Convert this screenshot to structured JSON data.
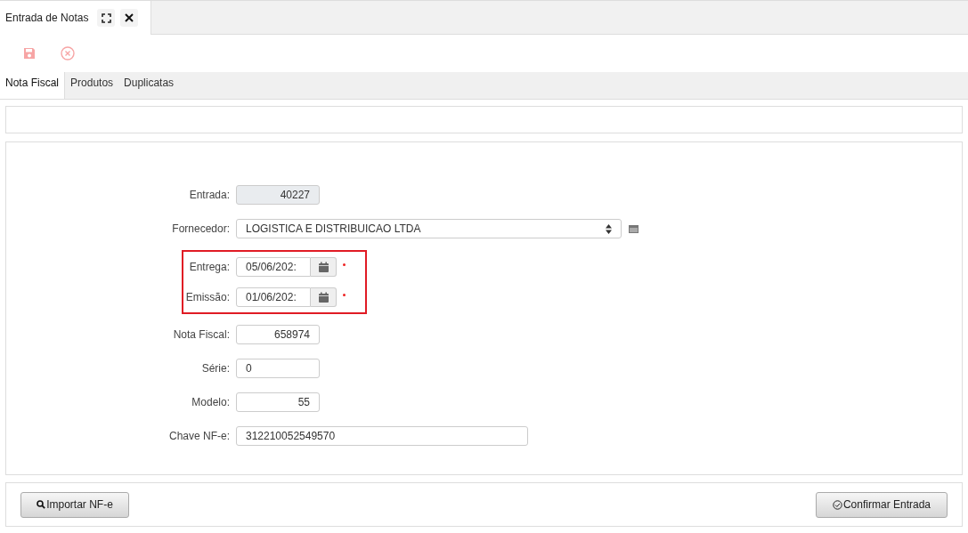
{
  "window_tab": {
    "title": "Entrada de Notas"
  },
  "toolbar": [
    {
      "kind": "save",
      "disabled": true
    },
    {
      "kind": "cancel",
      "disabled": true
    }
  ],
  "tabs": [
    {
      "label": "Nota Fiscal",
      "selected": true
    },
    {
      "label": "Produtos",
      "selected": false
    },
    {
      "label": "Duplicatas",
      "selected": false
    }
  ],
  "fields": [
    {
      "kind": "number",
      "label": "Entrada:",
      "value": "40227",
      "disabled": true
    },
    {
      "kind": "select",
      "label": "Fornecedor:",
      "value": "LOGISTICA E DISTRIBUICAO LTDA"
    },
    {
      "kind": "group",
      "highlighted": true,
      "children": [
        {
          "kind": "date",
          "label": "Entrega:",
          "value": "05/06/202:",
          "required": true
        },
        {
          "kind": "date",
          "label": "Emissão:",
          "value": "01/06/202:",
          "required": true
        }
      ]
    },
    {
      "kind": "number",
      "label": "Nota Fiscal:",
      "value": "658974",
      "disabled": false
    },
    {
      "kind": "text",
      "label": "Série:",
      "value": "0"
    },
    {
      "kind": "number",
      "label": "Modelo:",
      "value": "55",
      "disabled": false
    },
    {
      "kind": "key",
      "label": "Chave NF-e:",
      "value": "312210052549570"
    }
  ],
  "buttons": [
    {
      "kind": "import",
      "label": "Importar NF-e"
    },
    {
      "kind": "confirm",
      "label": "Confirmar Entrada"
    }
  ]
}
